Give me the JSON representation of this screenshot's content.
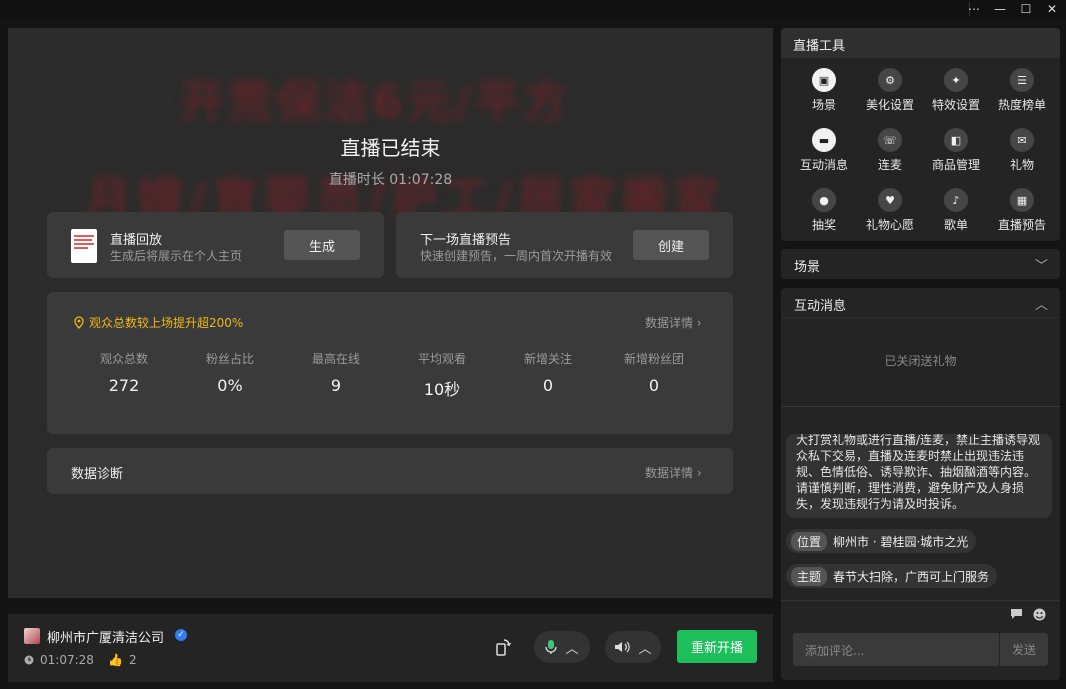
{
  "window": {
    "controls": [
      "⋯",
      "—",
      "☐",
      "✕"
    ]
  },
  "stage": {
    "banner_line1": "开荒保洁6元/平方",
    "banner_line2": "月嫂/育婴员/护工/居家搬家",
    "end_title": "直播已结束",
    "duration_label": "直播时长 01:07:28"
  },
  "replay": {
    "title": "直播回放",
    "subtitle": "生成后将展示在个人主页",
    "button": "生成"
  },
  "preview": {
    "title": "下一场直播预告",
    "subtitle": "快速创建预告，一周内首次开播有效",
    "button": "创建"
  },
  "stats": {
    "hint": "观众总数较上场提升超200%",
    "detail_link": "数据详情",
    "items": [
      {
        "label": "观众总数",
        "value": "272"
      },
      {
        "label": "粉丝占比",
        "value": "0%"
      },
      {
        "label": "最高在线",
        "value": "9"
      },
      {
        "label": "平均观看",
        "value": "10秒"
      },
      {
        "label": "新增关注",
        "value": "0"
      },
      {
        "label": "新增粉丝团",
        "value": "0"
      }
    ]
  },
  "diagnosis": {
    "title": "数据诊断",
    "detail_link": "数据详情"
  },
  "bottombar": {
    "company": "柳州市广厦清洁公司",
    "elapsed": "01:07:28",
    "likes": "2",
    "restart_button": "重新开播"
  },
  "tools": {
    "title": "直播工具",
    "items": [
      {
        "label": "场景",
        "icon": "scene-icon"
      },
      {
        "label": "美化设置",
        "icon": "beautify-icon"
      },
      {
        "label": "特效设置",
        "icon": "effects-icon"
      },
      {
        "label": "热度榜单",
        "icon": "ranking-icon"
      },
      {
        "label": "互动消息",
        "icon": "message-icon"
      },
      {
        "label": "连麦",
        "icon": "co-host-icon"
      },
      {
        "label": "商品管理",
        "icon": "shopping-bag-icon"
      },
      {
        "label": "礼物",
        "icon": "gift-icon"
      },
      {
        "label": "抽奖",
        "icon": "lottery-icon"
      },
      {
        "label": "礼物心愿",
        "icon": "wish-icon"
      },
      {
        "label": "歌单",
        "icon": "music-icon"
      },
      {
        "label": "直播预告",
        "icon": "calendar-icon"
      }
    ]
  },
  "scene_panel": {
    "title": "场景"
  },
  "messages_panel": {
    "title": "互动消息",
    "gifts_closed": "已关闭送礼物",
    "notice": "大打赏礼物或进行直播/连麦，禁止主播诱导观众私下交易，直播及连麦时禁止出现违法违规、色情低俗、诱导欺诈、抽烟酗酒等内容。请谨慎判断，理性消费，避免财产及人身损失，发现违规行为请及时投诉。",
    "location_tag": "位置",
    "location_value": "柳州市 · 碧桂园·城市之光",
    "topic_tag": "主题",
    "topic_value": "春节大扫除，广西可上门服务",
    "comment_placeholder": "添加评论...",
    "send_button": "发送"
  }
}
